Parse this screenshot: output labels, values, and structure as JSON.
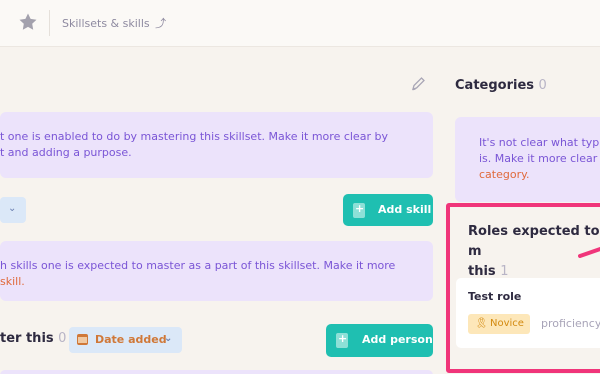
{
  "breadcrumb": {
    "label": "Skillsets & skills",
    "arrow": "⤴"
  },
  "purpose_box": {
    "line1": "t one is enabled to do by mastering this skillset. Make it more clear by",
    "line2": "t and adding a purpose."
  },
  "add_skill_label": "Add skill",
  "skills_box": {
    "line1": "h skills one is expected to master as a part of this skillset. Make it more",
    "line2": "skill."
  },
  "master_section": {
    "title": "ter this",
    "count": "0"
  },
  "date_filter": {
    "label": "Date added"
  },
  "add_person_label": "Add person",
  "categories": {
    "title": "Categories",
    "count": "0",
    "line1": "It's not clear what typ",
    "line2": "is. Make it more clear",
    "line3": "category."
  },
  "roles": {
    "title_line1": "Roles expected to m",
    "title_line2": "this",
    "count": "1",
    "card": {
      "name": "Test role",
      "level": "Novice",
      "trailing": "proficiency"
    }
  }
}
